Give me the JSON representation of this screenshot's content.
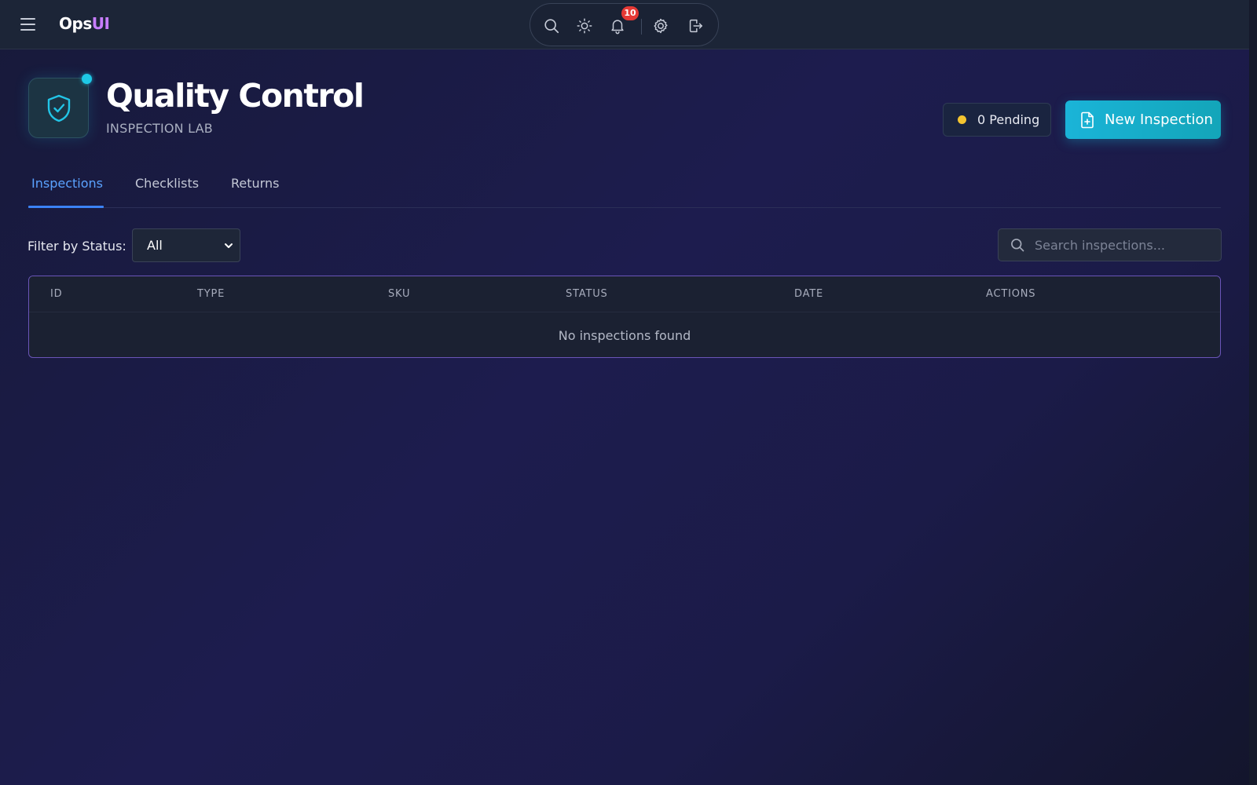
{
  "brand": {
    "name": "Ops",
    "accent": "UI"
  },
  "toolbar": {
    "icons": [
      "search-icon",
      "sun-icon",
      "bell-icon",
      "gear-icon",
      "logout-icon"
    ],
    "notification_count": "10"
  },
  "header": {
    "title": "Quality Control",
    "subtitle": "INSPECTION LAB",
    "pending_label": "0 Pending",
    "new_button_label": "New Inspection"
  },
  "tabs": [
    {
      "label": "Inspections",
      "active": true
    },
    {
      "label": "Checklists",
      "active": false
    },
    {
      "label": "Returns",
      "active": false
    }
  ],
  "filter": {
    "label": "Filter by Status:",
    "selected": "All"
  },
  "search": {
    "placeholder": "Search inspections..."
  },
  "table": {
    "columns": [
      "ID",
      "TYPE",
      "SKU",
      "STATUS",
      "DATE",
      "ACTIONS"
    ],
    "empty_message": "No inspections found"
  },
  "colors": {
    "accent": "#1ab4d8",
    "brand_accent": "#c77dff",
    "active_tab": "#5aa2ff",
    "pending_dot": "#f4c430",
    "badge": "#e53935",
    "table_border": "#6a55b8"
  }
}
